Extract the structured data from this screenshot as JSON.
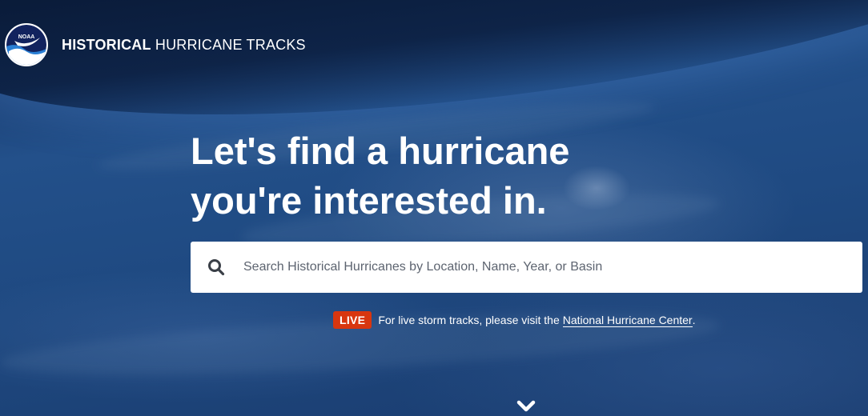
{
  "header": {
    "logo_alt": "NOAA",
    "title_strong": "HISTORICAL",
    "title_light": "HURRICANE TRACKS"
  },
  "hero": {
    "headline_line1": "Let's find a hurricane",
    "headline_line2": "you're interested in."
  },
  "search": {
    "placeholder": "Search Historical Hurricanes by Location, Name, Year, or Basin",
    "value": "",
    "icon": "search-icon"
  },
  "live_notice": {
    "badge": "LIVE",
    "text": "For live storm tracks, please visit the",
    "link_text": "National Hurricane Center",
    "suffix": "."
  },
  "scroll": {
    "icon": "chevron-down-icon"
  },
  "colors": {
    "background": "#23508a",
    "live_badge": "#d8360f",
    "noaa_blue": "#1f4fa8",
    "noaa_navy": "#12235e"
  }
}
